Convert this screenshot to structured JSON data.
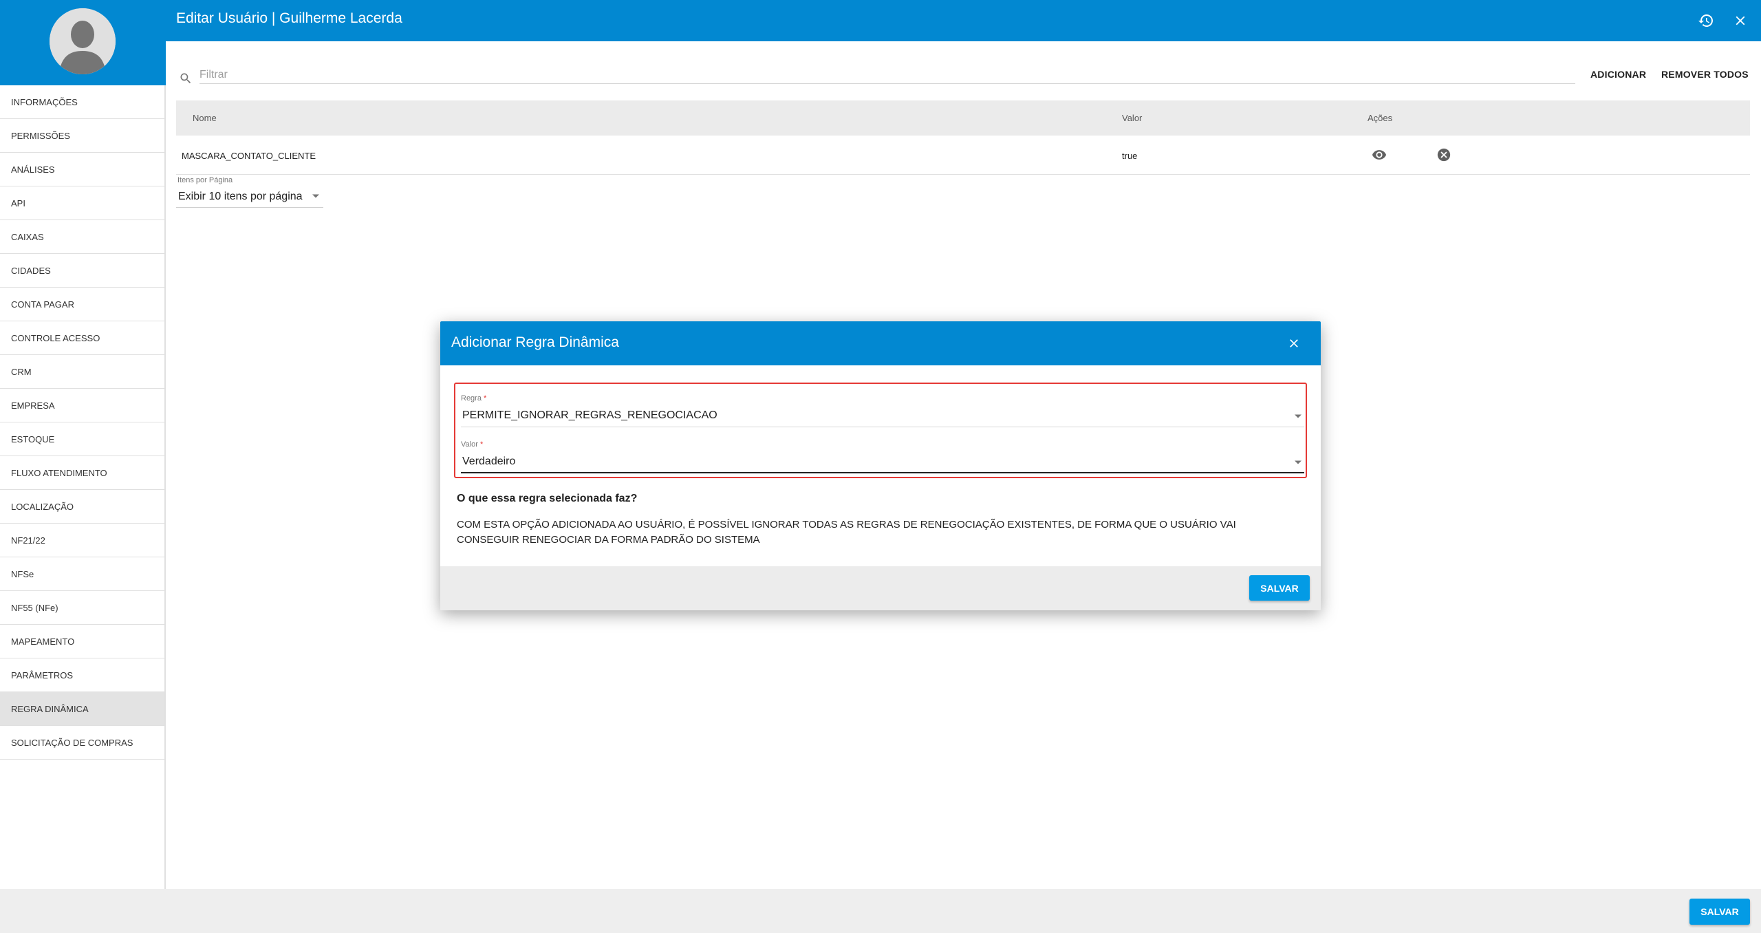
{
  "header": {
    "title": "Editar Usuário | Guilherme Lacerda",
    "history_icon": "history-icon",
    "close_icon": "close-icon",
    "color": "#0288d1"
  },
  "sidebar": {
    "items": [
      {
        "label": "INFORMAÇÕES"
      },
      {
        "label": "PERMISSÕES"
      },
      {
        "label": "ANÁLISES"
      },
      {
        "label": "API"
      },
      {
        "label": "CAIXAS"
      },
      {
        "label": "CIDADES"
      },
      {
        "label": "CONTA PAGAR"
      },
      {
        "label": "CONTROLE ACESSO"
      },
      {
        "label": "CRM"
      },
      {
        "label": "EMPRESA"
      },
      {
        "label": "ESTOQUE"
      },
      {
        "label": "FLUXO ATENDIMENTO"
      },
      {
        "label": "LOCALIZAÇÃO"
      },
      {
        "label": "NF21/22"
      },
      {
        "label": "NFSe"
      },
      {
        "label": "NF55 (NFe)"
      },
      {
        "label": "MAPEAMENTO"
      },
      {
        "label": "PARÂMETROS"
      },
      {
        "label": "REGRA DINÂMICA"
      },
      {
        "label": "SOLICITAÇÃO DE COMPRAS"
      }
    ],
    "active_item": "REGRA DINÂMICA"
  },
  "toolbar": {
    "filter_placeholder": "Filtrar",
    "filter_value": "",
    "add_label": "ADICIONAR",
    "remove_all_label": "REMOVER TODOS"
  },
  "table": {
    "columns": [
      "Nome",
      "Valor",
      "Ações"
    ],
    "rows": [
      {
        "name": "MASCARA_CONTATO_CLIENTE",
        "value": "true"
      }
    ]
  },
  "pagination": {
    "label": "Itens por Página",
    "selected": "Exibir 10 itens por página"
  },
  "modal": {
    "title": "Adicionar Regra Dinâmica",
    "rule_label": "Regra",
    "rule_value": "PERMITE_IGNORAR_REGRAS_RENEGOCIACAO",
    "value_label": "Valor",
    "value_value": "Verdadeiro",
    "required_mark": "*",
    "question": "O que essa regra selecionada faz?",
    "description": "COM ESTA OPÇÃO ADICIONADA AO USUÁRIO, É POSSÍVEL IGNORAR TODAS AS REGRAS DE RENEGOCIAÇÃO EXISTENTES, DE FORMA QUE O USUÁRIO VAI CONSEGUIR RENEGOCIAR DA FORMA PADRÃO DO SISTEMA",
    "save_label": "SALVAR",
    "error_color": "#e53935"
  },
  "footer": {
    "save_label": "SALVAR",
    "button_color": "#039be5"
  }
}
